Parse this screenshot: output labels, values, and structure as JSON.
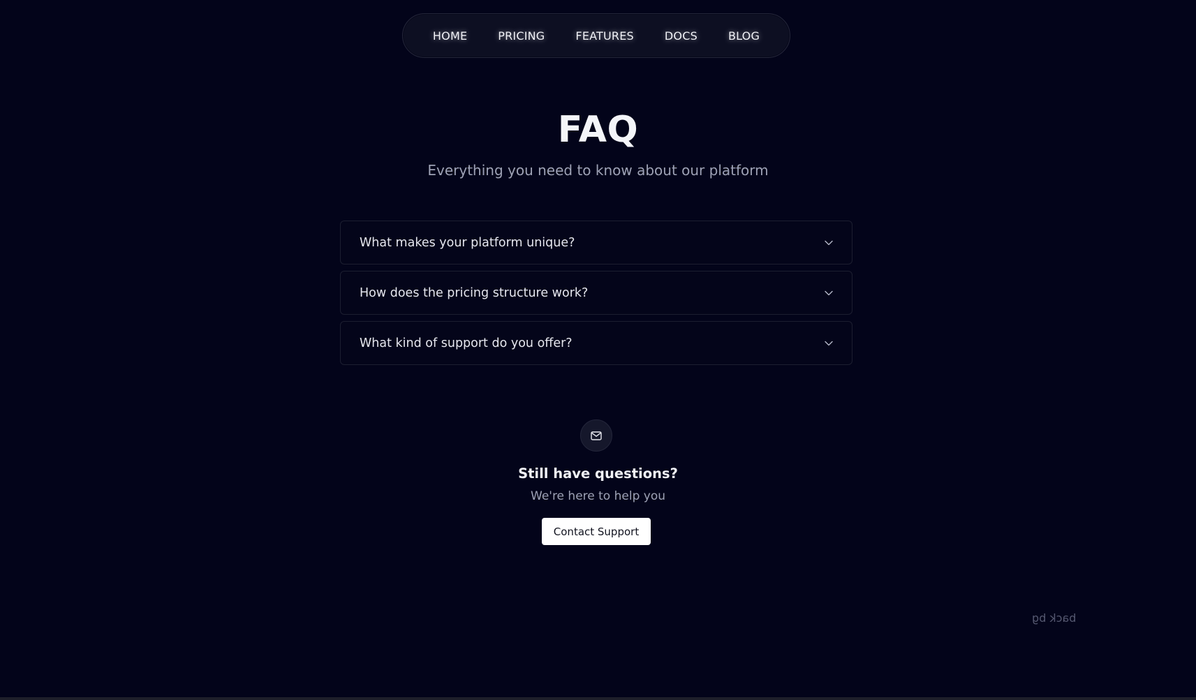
{
  "nav": {
    "items": [
      "HOME",
      "PRICING",
      "FEATURES",
      "DOCS",
      "BLOG"
    ]
  },
  "hero": {
    "title": "FAQ",
    "subtitle": "Everything you need to know about our platform"
  },
  "faq": {
    "questions": [
      "What makes your platform unique?",
      "How does the pricing structure work?",
      "What kind of support do you offer?"
    ],
    "expand_icon": "chevron-down-icon"
  },
  "support": {
    "icon": "mail-icon",
    "title": "Still have questions?",
    "subtitle": "We're here to help you",
    "button_label": "Contact Support"
  },
  "footer": {
    "mirrored_text": "back bg"
  },
  "colors": {
    "background": "#03041a",
    "nav_bg": "#0d0f22",
    "card_border": "#1c1e30",
    "muted_text": "#9ea2b5",
    "button_bg": "#ffffff"
  }
}
